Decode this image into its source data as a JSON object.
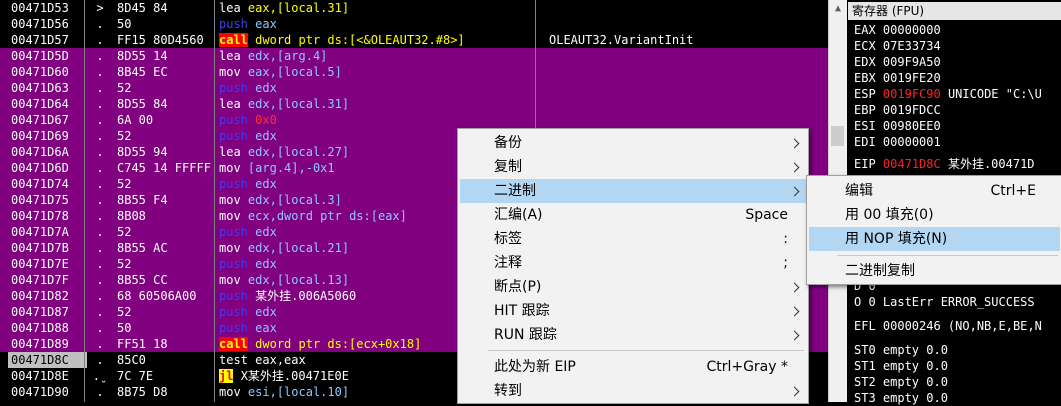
{
  "disasm": {
    "rows": [
      {
        "addr": "00471D53",
        "mark": ">",
        "hex": "8D45 84",
        "mnem": "lea",
        "ops": "eax,[local.31]",
        "kind": "normal",
        "opsColor": "y",
        "comment": "",
        "sel": false
      },
      {
        "addr": "00471D56",
        "mark": ".",
        "hex": "50",
        "mnem": "push",
        "ops": "eax",
        "kind": "push",
        "opsColor": "c",
        "comment": "",
        "sel": false
      },
      {
        "addr": "00471D57",
        "mark": ".",
        "hex": "FF15 80D4560",
        "mnem": "call",
        "ops": "dword ptr ds:[<&OLEAUT32.#8>]",
        "kind": "call",
        "opsColor": "y",
        "comment": "OLEAUT32.VariantInit",
        "sel": false
      },
      {
        "addr": "00471D5D",
        "mark": ".",
        "hex": "8D55 14",
        "mnem": "lea",
        "ops": "edx,[arg.4]",
        "kind": "normal",
        "opsColor": "c",
        "comment": "",
        "sel": true
      },
      {
        "addr": "00471D60",
        "mark": ".",
        "hex": "8B45 EC",
        "mnem": "mov",
        "ops": "eax,[local.5]",
        "kind": "normal",
        "opsColor": "c",
        "comment": "",
        "sel": true
      },
      {
        "addr": "00471D63",
        "mark": ".",
        "hex": "52",
        "mnem": "push",
        "ops": "edx",
        "kind": "push",
        "opsColor": "c",
        "comment": "",
        "sel": true
      },
      {
        "addr": "00471D64",
        "mark": ".",
        "hex": "8D55 84",
        "mnem": "lea",
        "ops": "edx,[local.31]",
        "kind": "normal",
        "opsColor": "c",
        "comment": "",
        "sel": true
      },
      {
        "addr": "00471D67",
        "mark": ".",
        "hex": "6A 00",
        "mnem": "push",
        "ops": "0x0",
        "kind": "push",
        "opsColor": "imm",
        "comment": "",
        "sel": true
      },
      {
        "addr": "00471D69",
        "mark": ".",
        "hex": "52",
        "mnem": "push",
        "ops": "edx",
        "kind": "push",
        "opsColor": "c",
        "comment": "",
        "sel": true
      },
      {
        "addr": "00471D6A",
        "mark": ".",
        "hex": "8D55 94",
        "mnem": "lea",
        "ops": "edx,[local.27]",
        "kind": "normal",
        "opsColor": "c",
        "comment": "",
        "sel": true
      },
      {
        "addr": "00471D6D",
        "mark": ".",
        "hex": "C745 14 FFFFF",
        "mnem": "mov",
        "ops": "[arg.4],-0x1",
        "kind": "normal",
        "opsColor": "c",
        "comment": "",
        "sel": true
      },
      {
        "addr": "00471D74",
        "mark": ".",
        "hex": "52",
        "mnem": "push",
        "ops": "edx",
        "kind": "push",
        "opsColor": "c",
        "comment": "",
        "sel": true
      },
      {
        "addr": "00471D75",
        "mark": ".",
        "hex": "8B55 F4",
        "mnem": "mov",
        "ops": "edx,[local.3]",
        "kind": "normal",
        "opsColor": "c",
        "comment": "",
        "sel": true
      },
      {
        "addr": "00471D78",
        "mark": ".",
        "hex": "8B08",
        "mnem": "mov",
        "ops": "ecx,dword ptr ds:[eax]",
        "kind": "normal",
        "opsColor": "c",
        "comment": "",
        "sel": true
      },
      {
        "addr": "00471D7A",
        "mark": ".",
        "hex": "52",
        "mnem": "push",
        "ops": "edx",
        "kind": "push",
        "opsColor": "c",
        "comment": "",
        "sel": true
      },
      {
        "addr": "00471D7B",
        "mark": ".",
        "hex": "8B55 AC",
        "mnem": "mov",
        "ops": "edx,[local.21]",
        "kind": "normal",
        "opsColor": "c",
        "comment": "",
        "sel": true
      },
      {
        "addr": "00471D7E",
        "mark": ".",
        "hex": "52",
        "mnem": "push",
        "ops": "edx",
        "kind": "push",
        "opsColor": "c",
        "comment": "",
        "sel": true
      },
      {
        "addr": "00471D7F",
        "mark": ".",
        "hex": "8B55 CC",
        "mnem": "mov",
        "ops": "edx,[local.13]",
        "kind": "normal",
        "opsColor": "c",
        "comment": "",
        "sel": true
      },
      {
        "addr": "00471D82",
        "mark": ".",
        "hex": "68 60506A00",
        "mnem": "push",
        "ops": "某外挂.006A5060",
        "kind": "push",
        "opsColor": "w",
        "comment": "",
        "sel": true
      },
      {
        "addr": "00471D87",
        "mark": ".",
        "hex": "52",
        "mnem": "push",
        "ops": "edx",
        "kind": "push",
        "opsColor": "c",
        "comment": "",
        "sel": true
      },
      {
        "addr": "00471D88",
        "mark": ".",
        "hex": "50",
        "mnem": "push",
        "ops": "eax",
        "kind": "push",
        "opsColor": "c",
        "comment": "",
        "sel": true
      },
      {
        "addr": "00471D89",
        "mark": ".",
        "hex": "FF51 18",
        "mnem": "call",
        "ops": "dword ptr ds:[ecx+0x18]",
        "kind": "call",
        "opsColor": "y",
        "comment": "",
        "sel": true
      },
      {
        "addr": "00471D8C",
        "mark": ".",
        "hex": "85C0",
        "mnem": "test",
        "ops": "eax,eax",
        "kind": "normal",
        "opsColor": "w",
        "comment": "",
        "sel": false,
        "cur": true
      },
      {
        "addr": "00471D8E",
        "mark": ".ˬ",
        "hex": "7C 7E",
        "mnem": "jl",
        "ops": "X某外挂.00471E0E",
        "kind": "jcc",
        "opsColor": "w",
        "comment": "",
        "sel": false
      },
      {
        "addr": "00471D90",
        "mark": ".",
        "hex": "8B75 D8",
        "mnem": "mov",
        "ops": "esi,[local.10]",
        "kind": "normal",
        "opsColor": "c",
        "comment": "",
        "sel": false
      }
    ]
  },
  "registers": {
    "title": "寄存器 (FPU)",
    "lines": [
      {
        "name": "EAX",
        "value": "00000000",
        "extra": "",
        "red": false
      },
      {
        "name": "ECX",
        "value": "07E33734",
        "extra": "",
        "red": false
      },
      {
        "name": "EDX",
        "value": "009F9A50",
        "extra": "",
        "red": false
      },
      {
        "name": "EBX",
        "value": "0019FE20",
        "extra": "",
        "red": false
      },
      {
        "name": "ESP",
        "value": "0019FC90",
        "extra": "UNICODE \"C:\\U",
        "red": true
      },
      {
        "name": "EBP",
        "value": "0019FDCC",
        "extra": "",
        "red": false
      },
      {
        "name": "ESI",
        "value": "00980EE0",
        "extra": "",
        "red": false
      },
      {
        "name": "EDI",
        "value": "00000001",
        "extra": "",
        "red": false
      },
      {
        "name": "EIP",
        "value": "00471D8C",
        "extra": "某外挂.00471D",
        "red": true
      }
    ],
    "lower": [
      {
        "text": "D 0"
      },
      {
        "text": "O 0  LastErr ERROR_SUCCESS"
      },
      {
        "text": "EFL 00000246 (NO,NB,E,BE,N"
      },
      {
        "text": "ST0 empty 0.0"
      },
      {
        "text": "ST1 empty 0.0"
      },
      {
        "text": "ST2 empty 0.0"
      },
      {
        "text": "ST3 empty 0.0"
      }
    ]
  },
  "context_menu": {
    "items": [
      {
        "label": "备份",
        "shortcut": "",
        "submenu": true
      },
      {
        "label": "复制",
        "shortcut": "",
        "submenu": true
      },
      {
        "label": "二进制",
        "shortcut": "",
        "submenu": true,
        "highlighted": true
      },
      {
        "label": "汇编(A)",
        "shortcut": "Space",
        "submenu": false
      },
      {
        "label": "标签",
        "shortcut": ":",
        "submenu": false
      },
      {
        "label": "注释",
        "shortcut": ";",
        "submenu": false
      },
      {
        "label": "断点(P)",
        "shortcut": "",
        "submenu": true
      },
      {
        "label": "HIT 跟踪",
        "shortcut": "",
        "submenu": true
      },
      {
        "label": "RUN 跟踪",
        "shortcut": "",
        "submenu": true
      },
      {
        "label": "此处为新 EIP",
        "shortcut": "Ctrl+Gray *",
        "submenu": false
      },
      {
        "label": "转到",
        "shortcut": "",
        "submenu": true
      }
    ]
  },
  "binary_submenu": {
    "items": [
      {
        "label": "编辑",
        "shortcut": "Ctrl+E"
      },
      {
        "label": "用 00 填充(0)",
        "shortcut": ""
      },
      {
        "label": "用 NOP 填充(N)",
        "shortcut": "",
        "highlighted": true
      },
      {
        "label": "二进制复制",
        "shortcut": ""
      }
    ]
  }
}
